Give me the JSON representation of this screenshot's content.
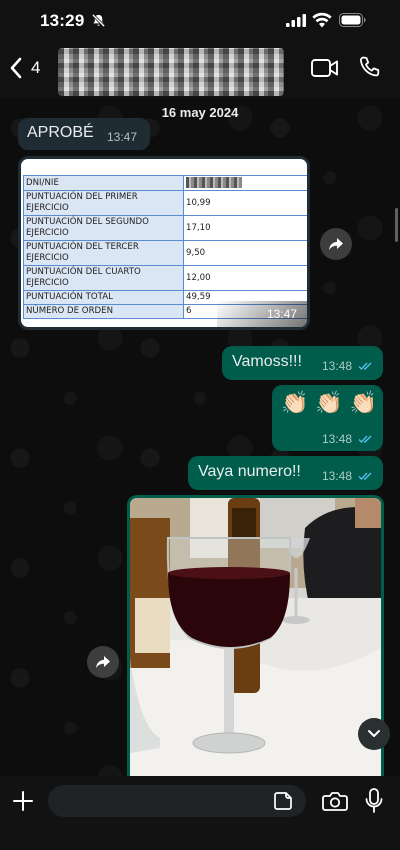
{
  "status_bar": {
    "time": "13:29"
  },
  "header": {
    "back_count": "4",
    "contact_name_redacted": true
  },
  "chat": {
    "date": "16 may 2024",
    "messages": [
      {
        "direction": "in",
        "text": "APROBÉ",
        "time": "13:47"
      },
      {
        "direction": "in",
        "type": "image-document",
        "time": "13:47",
        "document": {
          "rows": [
            {
              "label": "DNI/NIE",
              "value": ""
            },
            {
              "label": "PUNTUACIÓN DEL PRIMER EJERCICIO",
              "value": "10,99"
            },
            {
              "label": "PUNTUACIÓN DEL SEGUNDO EJERCICIO",
              "value": "17,10"
            },
            {
              "label": "PUNTUACIÓN DEL TERCER EJERCICIO",
              "value": "9,50"
            },
            {
              "label": "PUNTUACIÓN DEL CUARTO EJERCICIO",
              "value": "12,00"
            },
            {
              "label": "PUNTUACIÓN TOTAL",
              "value": "49,59"
            },
            {
              "label": "NÚMERO DE ORDEN",
              "value": "6"
            }
          ]
        }
      },
      {
        "direction": "out",
        "text": "Vamoss!!!",
        "time": "13:48",
        "read": true
      },
      {
        "direction": "out",
        "text": "👏🏻 👏🏻 👏🏻",
        "time": "13:48",
        "read": true
      },
      {
        "direction": "out",
        "text": "Vaya numero!!",
        "time": "13:48",
        "read": true
      },
      {
        "direction": "out",
        "type": "photo"
      }
    ]
  },
  "input": {
    "placeholder": ""
  },
  "colors": {
    "incoming_bubble": "#202c33",
    "outgoing_bubble": "#005c4b",
    "read_ticks": "#53bdeb",
    "background": "#0b0b0b"
  },
  "icons": [
    "bell-off-icon",
    "signal-icon",
    "wifi-icon",
    "battery-icon",
    "chevron-left-icon",
    "video-call-icon",
    "phone-icon",
    "forward-icon",
    "chevron-down-icon",
    "plus-icon",
    "sticker-icon",
    "camera-icon",
    "microphone-icon"
  ]
}
